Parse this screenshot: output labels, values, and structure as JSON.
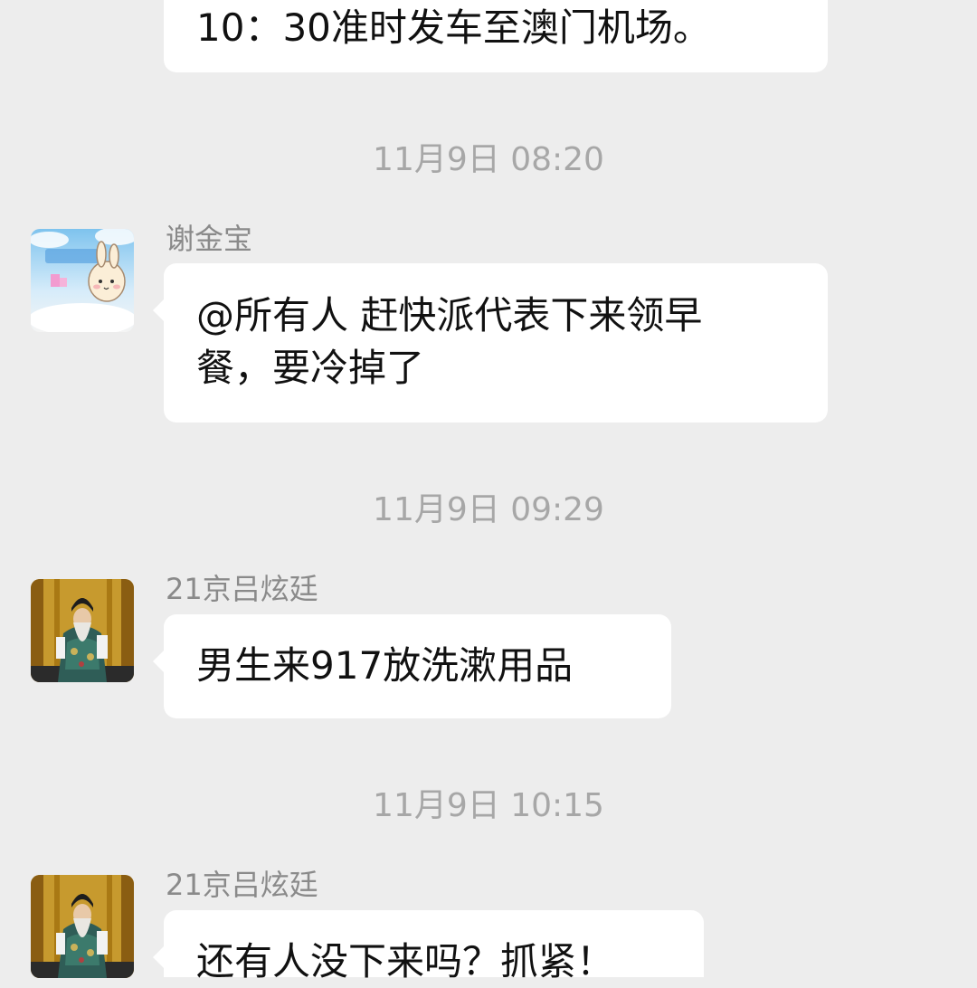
{
  "messages": [
    {
      "text": "10：30准时发车至澳门机场。"
    },
    {
      "timestamp": "11月9日 08:20",
      "sender": "谢金宝",
      "avatar": "cartoon-bunny-avatar",
      "text": "@所有人 赶快派代表下来领早餐，要冷掉了",
      "line1": "@所有人 赶快派代表下来领早",
      "line2": "餐，要冷掉了"
    },
    {
      "timestamp": "11月9日 09:29",
      "sender": "21京吕炫廷",
      "avatar": "opera-performer-avatar",
      "text": "男生来917放洗漱用品"
    },
    {
      "timestamp": "11月9日 10:15",
      "sender": "21京吕炫廷",
      "avatar": "opera-performer-avatar",
      "text": "还有人没下来吗？抓紧！"
    }
  ],
  "colors": {
    "background": "#ededed",
    "bubble": "#ffffff",
    "timestamp": "#a7a7a7",
    "sender": "#8a8a8a"
  }
}
